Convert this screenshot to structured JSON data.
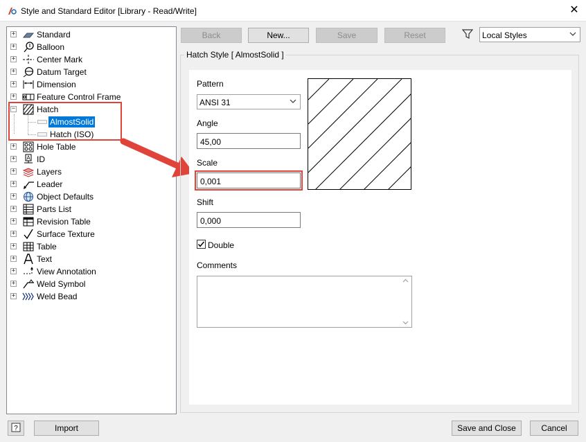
{
  "window": {
    "title": "Style and Standard Editor [Library - Read/Write]"
  },
  "tree": {
    "items": [
      {
        "label": "Standard",
        "icon": "standard-icon"
      },
      {
        "label": "Balloon",
        "icon": "balloon-icon"
      },
      {
        "label": "Center Mark",
        "icon": "center-mark-icon"
      },
      {
        "label": "Datum Target",
        "icon": "datum-target-icon"
      },
      {
        "label": "Dimension",
        "icon": "dimension-icon"
      },
      {
        "label": "Feature Control Frame",
        "icon": "feature-control-frame-icon"
      },
      {
        "label": "Hatch",
        "icon": "hatch-icon"
      },
      {
        "label": "Hole Table",
        "icon": "hole-table-icon"
      },
      {
        "label": "ID",
        "icon": "id-icon"
      },
      {
        "label": "Layers",
        "icon": "layers-icon"
      },
      {
        "label": "Leader",
        "icon": "leader-icon"
      },
      {
        "label": "Object Defaults",
        "icon": "object-defaults-icon"
      },
      {
        "label": "Parts List",
        "icon": "parts-list-icon"
      },
      {
        "label": "Revision Table",
        "icon": "revision-table-icon"
      },
      {
        "label": "Surface Texture",
        "icon": "surface-texture-icon"
      },
      {
        "label": "Table",
        "icon": "table-icon"
      },
      {
        "label": "Text",
        "icon": "text-icon"
      },
      {
        "label": "View Annotation",
        "icon": "view-annotation-icon"
      },
      {
        "label": "Weld Symbol",
        "icon": "weld-symbol-icon"
      },
      {
        "label": "Weld Bead",
        "icon": "weld-bead-icon"
      }
    ],
    "hatch_children": [
      {
        "label": "AlmostSolid",
        "selected": true
      },
      {
        "label": "Hatch (ISO)",
        "selected": false
      }
    ]
  },
  "toolbar": {
    "back_label": "Back",
    "new_label": "New...",
    "save_label": "Save",
    "reset_label": "Reset",
    "filter_value": "Local Styles"
  },
  "hatch_style": {
    "group_title": "Hatch Style [ AlmostSolid ]",
    "pattern_label": "Pattern",
    "pattern_value": "ANSI 31",
    "angle_label": "Angle",
    "angle_value": "45,00",
    "scale_label": "Scale",
    "scale_value": "0,001",
    "shift_label": "Shift",
    "shift_value": "0,000",
    "double_label": "Double",
    "double_checked": true,
    "comments_label": "Comments",
    "comments_value": ""
  },
  "footer": {
    "import_label": "Import",
    "save_close_label": "Save and Close",
    "cancel_label": "Cancel"
  },
  "colors": {
    "highlight": "#e0433a",
    "selection": "#0078d7"
  }
}
